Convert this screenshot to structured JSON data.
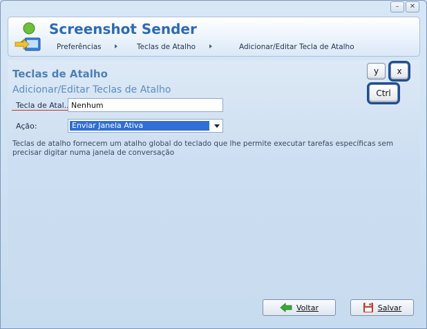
{
  "app": {
    "title": "Screenshot Sender"
  },
  "window": {
    "minimize": "–",
    "close": "✕"
  },
  "breadcrumb": [
    {
      "label": "Preferências"
    },
    {
      "label": "Teclas de Atalho"
    },
    {
      "label": "Adicionar/Editar Tecla de Atalho"
    }
  ],
  "section": {
    "title": "Teclas de Atalho",
    "subtitle": "Adicionar/Editar Teclas de Atalho"
  },
  "form": {
    "hotkey_label": "Tecla de Atal...",
    "hotkey_value": "Nenhum",
    "action_label": "Ação:",
    "action_value": "Enviar Janela Ativa"
  },
  "description": "Teclas de atalho fornecem um atalho global do teclado que lhe permite executar tarefas específicas sem precisar digitar numa janela de conversação",
  "keys": {
    "y": "y",
    "x": "x",
    "ctrl": "Ctrl"
  },
  "buttons": {
    "back": "Voltar",
    "save": "Salvar"
  },
  "colors": {
    "accent": "#2e6ab3",
    "selection": "#2f6fd6",
    "underline": "#c0392b",
    "back_arrow": "#3aa83a"
  }
}
